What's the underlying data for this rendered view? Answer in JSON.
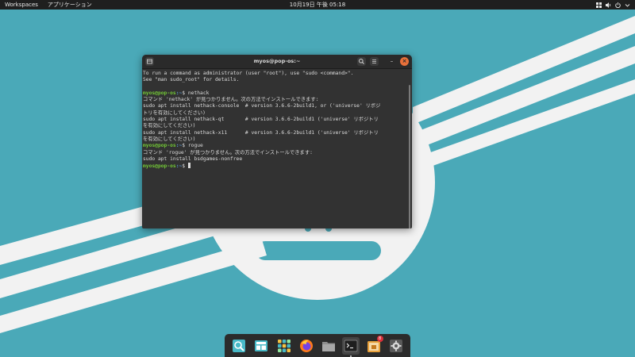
{
  "topbar": {
    "workspaces_label": "Workspaces",
    "applications_label": "アプリケーション",
    "clock": "10月19日 午後 05:18",
    "tray_icons": [
      "app-grid-icon",
      "volume-icon",
      "power-icon",
      "menu-arrow-icon"
    ]
  },
  "terminal": {
    "title": "myos@pop-os:~",
    "buttons": {
      "new_tab_icon": "new-tab-icon",
      "search_icon": "search-icon",
      "menu_icon": "hamburger-menu-icon",
      "minimize_glyph": "–",
      "close_glyph": "×"
    },
    "lines": [
      {
        "text": "To run a command as administrator (user \"root\"), use \"sudo <command>\"."
      },
      {
        "text": "See \"man sudo_root\" for details."
      },
      {
        "text": ""
      },
      {
        "user": "myos@pop-os",
        "path": ":~",
        "cmd": "$ nethack"
      },
      {
        "text": "コマンド 'nethack' が見つかりません。次の方法でインストールできます:"
      },
      {
        "text": "sudo apt install nethack-console  # version 3.6.6-2build1, or ('universe' リポジ"
      },
      {
        "text": "トリを有効にしてください)"
      },
      {
        "text": "sudo apt install nethack-qt       # version 3.6.6-2build1 ('universe' リポジトリ"
      },
      {
        "text": "を有効にしてください)"
      },
      {
        "text": "sudo apt install nethack-x11      # version 3.6.6-2build1 ('universe' リポジトリ"
      },
      {
        "text": "を有効にしてください)"
      },
      {
        "user": "myos@pop-os",
        "path": ":~",
        "cmd": "$ rogue"
      },
      {
        "text": "コマンド 'rogue' が見つかりません。次の方法でインストールできます:"
      },
      {
        "text": "sudo apt install bsdgames-nonfree"
      },
      {
        "user": "myos@pop-os",
        "path": ":~",
        "cmd": "$ ",
        "cursor": true
      }
    ]
  },
  "dock": {
    "items": [
      {
        "name": "workspaces-icon"
      },
      {
        "name": "desktop-icon"
      },
      {
        "name": "applications-icon"
      },
      {
        "name": "firefox-icon"
      },
      {
        "name": "files-icon"
      },
      {
        "name": "terminal-icon",
        "active": true
      },
      {
        "name": "pop-shop-icon",
        "badge": "8"
      },
      {
        "name": "settings-icon"
      }
    ]
  },
  "colors": {
    "wallpaper": "#4aa9b8",
    "topbar": "#1f1f1f",
    "terminal_bg": "#323232",
    "prompt_user": "#73c936",
    "prompt_path": "#5b9bd5",
    "close_button": "#e8703a"
  }
}
